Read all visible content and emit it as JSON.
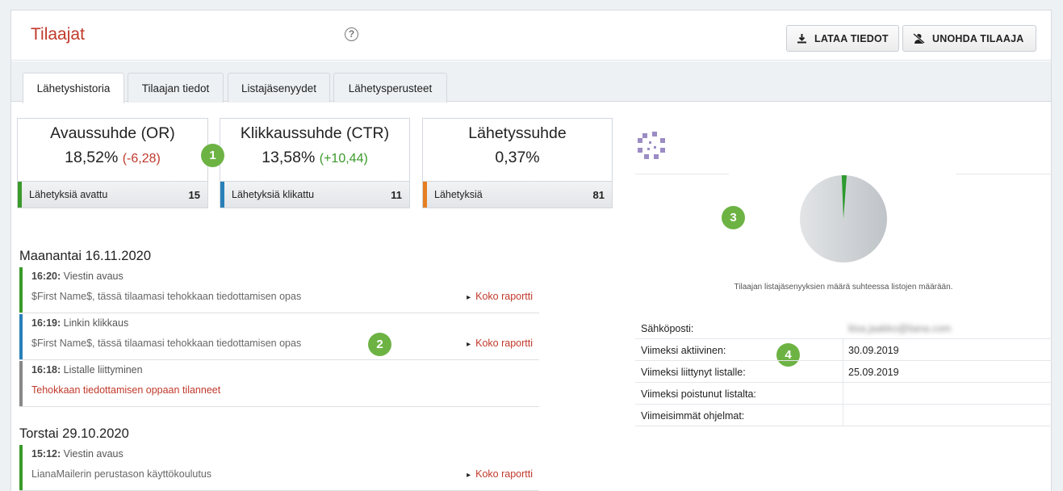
{
  "header": {
    "title": "Tilaajat",
    "help_icon": "question-circle-icon",
    "download_label": "LATAA TIEDOT",
    "forget_label": "UNOHDA TILAAJA"
  },
  "tabs": [
    "Lähetyshistoria",
    "Tilaajan tiedot",
    "Listajäsenyydet",
    "Lähetysperusteet"
  ],
  "stats": [
    {
      "label": "Avaussuhde (OR)",
      "value": "18,52%",
      "delta": "(-6,28)",
      "foot_label": "Lähetyksiä avattu",
      "count": "15",
      "color": "#3a9a2a"
    },
    {
      "label": "Klikkaussuhde (CTR)",
      "value": "13,58%",
      "delta": "(+10,44)",
      "foot_label": "Lähetyksiä klikattu",
      "count": "11",
      "color": "#2980b9"
    },
    {
      "label": "Lähetyssuhde",
      "value": "0,37%",
      "delta": "",
      "foot_label": "Lähetyksiä",
      "count": "81",
      "color": "#e67e22"
    }
  ],
  "badges": [
    "1",
    "2",
    "3",
    "4"
  ],
  "history": [
    {
      "date": "Maanantai 16.11.2020",
      "events": [
        {
          "time": "16:20:",
          "type": "Viestin avaus",
          "subject": "$First Name$, tässä tilaamasi tehokkaan tiedottamisen opas",
          "report": "Koko raportti",
          "color": "#3a9a2a"
        },
        {
          "time": "16:19:",
          "type": "Linkin klikkaus",
          "subject": "$First Name$, tässä tilaamasi tehokkaan tiedottamisen opas",
          "report": "Koko raportti",
          "color": "#2980b9"
        },
        {
          "time": "16:18:",
          "type": "Listalle liittyminen",
          "subject": "Tehokkaan tiedottamisen oppaan tilanneet",
          "report": "",
          "color": "#888888"
        }
      ]
    },
    {
      "date": "Torstai 29.10.2020",
      "events": [
        {
          "time": "15:12:",
          "type": "Viestin avaus",
          "subject": "LianaMailerin perustason käyttökoulutus",
          "report": "Koko raportti",
          "color": "#3a9a2a"
        }
      ]
    }
  ],
  "pie": {
    "caption": "Tilaajan listajäsenyyksien määrä suhteessa listojen määrään.",
    "share": 0.015,
    "color_main": "#bfc4c8",
    "color_slice": "#2e9a2e"
  },
  "info": [
    {
      "key": "Sähköposti:",
      "value": "liisa.jaakko@liana.com",
      "blurred": true
    },
    {
      "key": "Viimeksi aktiivinen:",
      "value": "30.09.2019",
      "blurred": false
    },
    {
      "key": "Viimeksi liittynyt listalle:",
      "value": "25.09.2019",
      "blurred": false
    },
    {
      "key": "Viimeksi poistunut listalta:",
      "value": "",
      "blurred": false
    },
    {
      "key": "Viimeisimmät ohjelmat:",
      "value": "",
      "blurred": false
    }
  ]
}
